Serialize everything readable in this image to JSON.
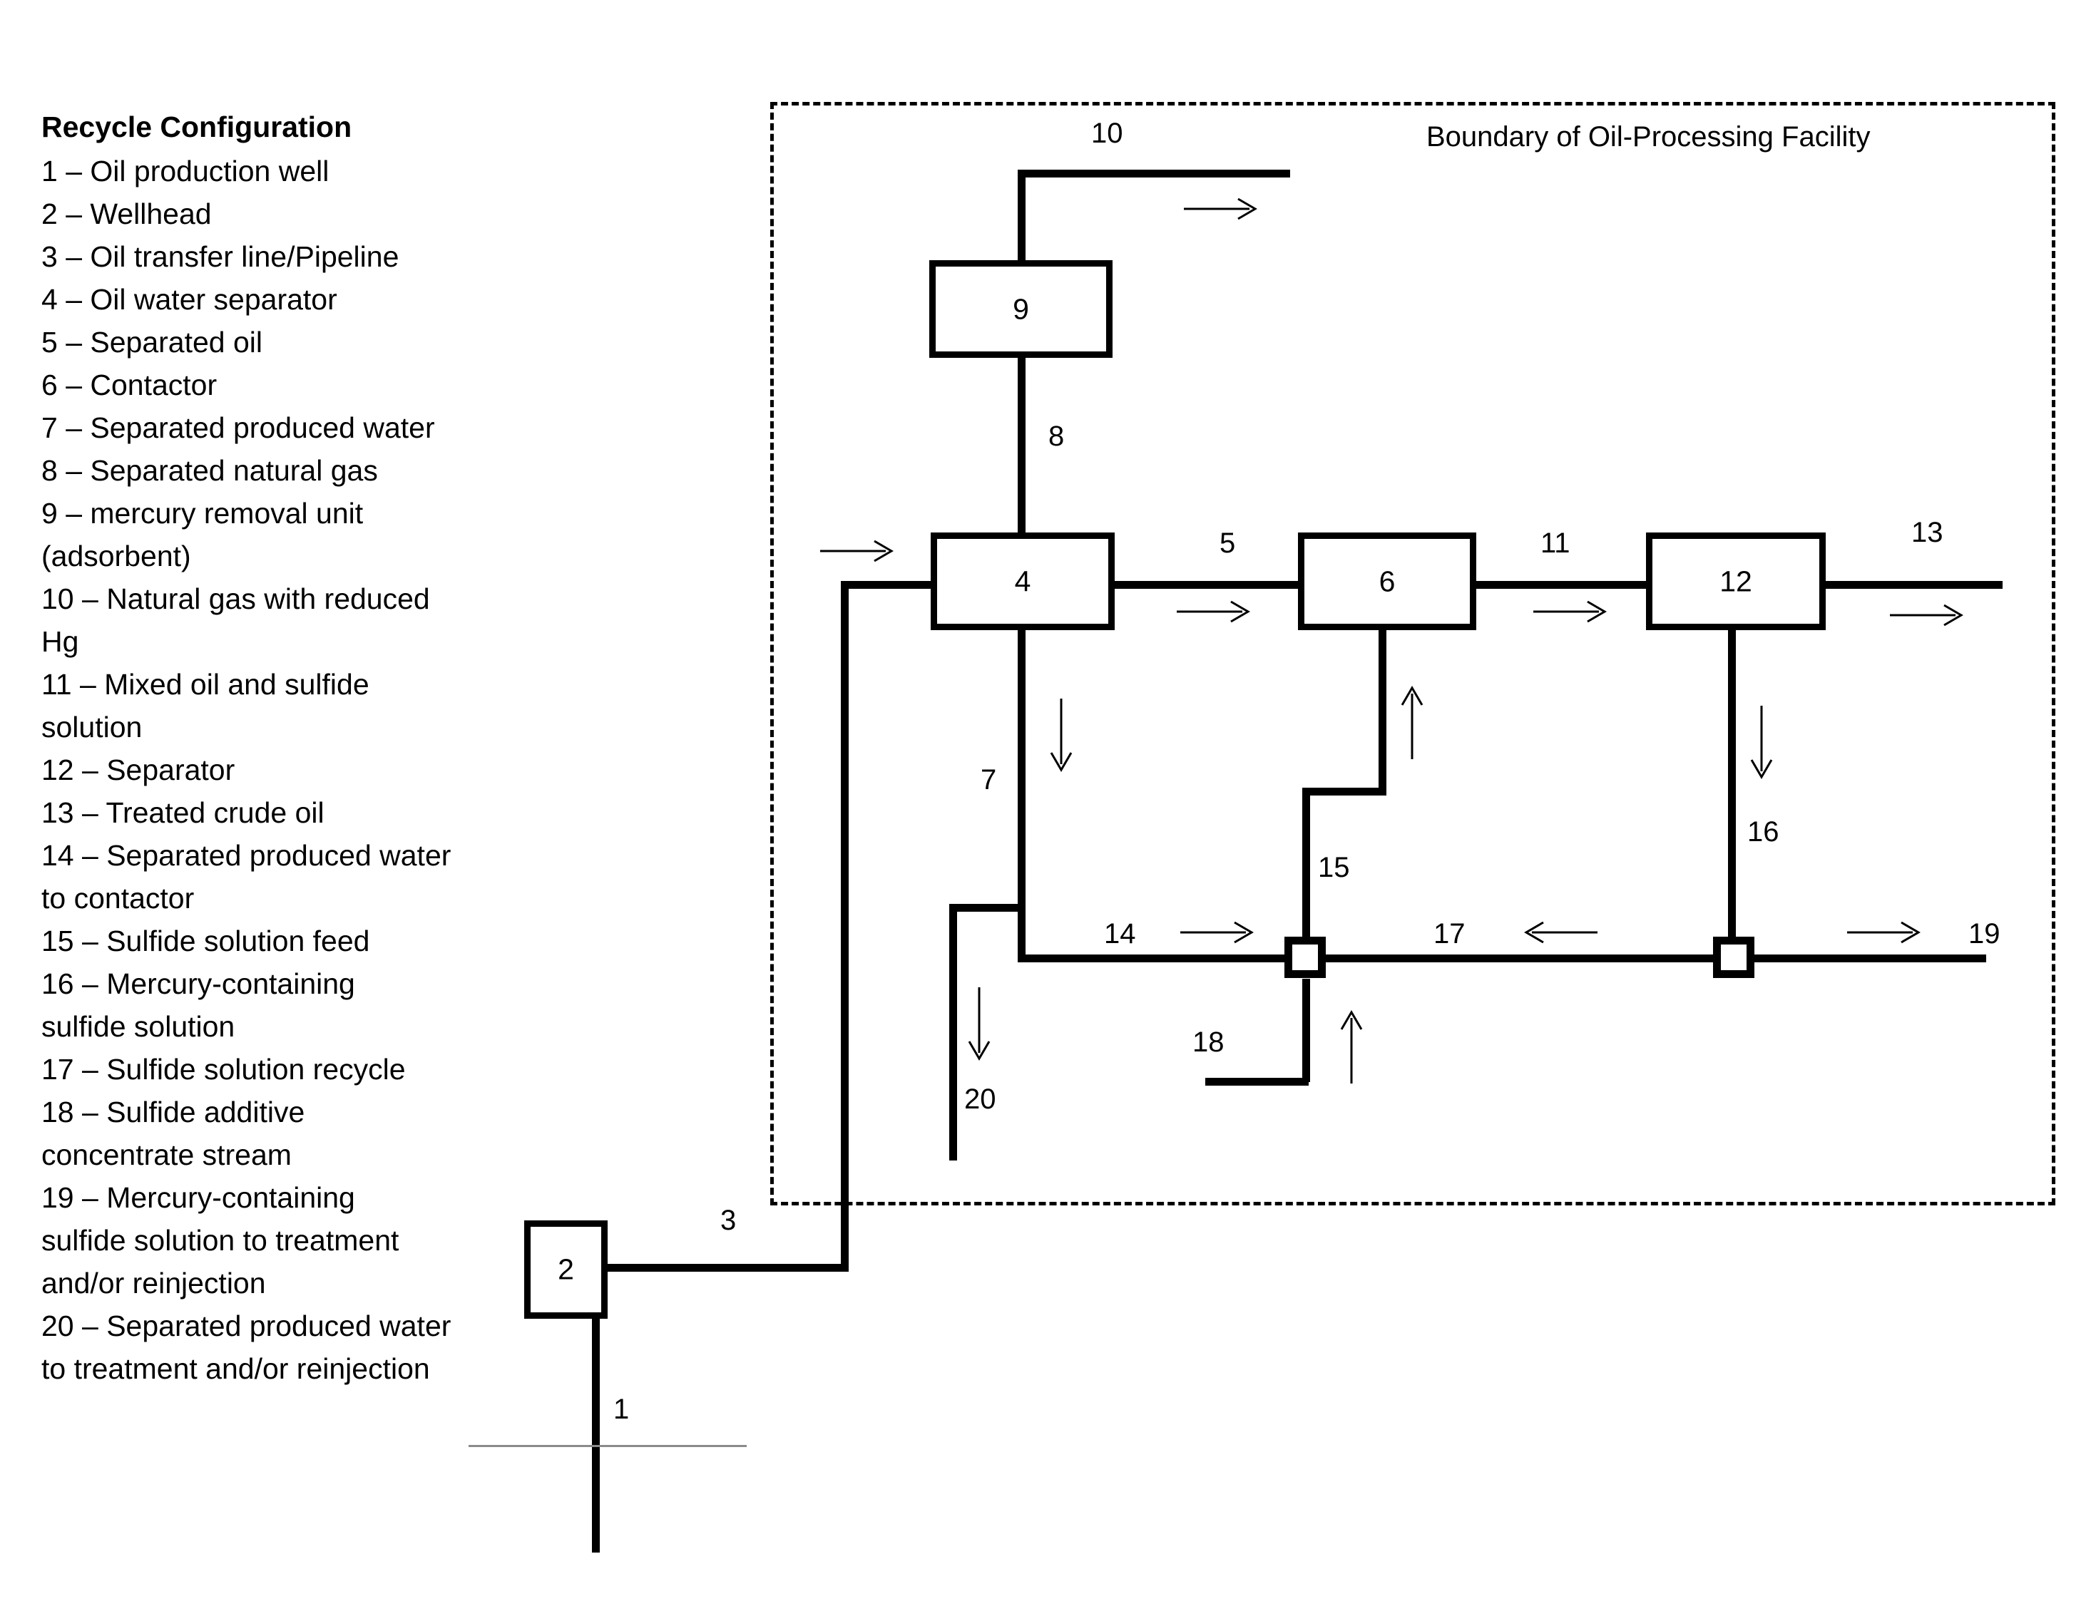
{
  "legend": {
    "title": "Recycle Configuration",
    "items": [
      "1 – Oil production well",
      "2 – Wellhead",
      "3 – Oil transfer line/Pipeline",
      "4 – Oil water separator",
      "5 – Separated oil",
      "6 – Contactor",
      "7 – Separated  produced water",
      "8 – Separated natural gas",
      "9 – mercury removal unit",
      "(adsorbent)",
      "10 – Natural gas with reduced",
      "Hg",
      "11 – Mixed oil and sulfide",
      "solution",
      "12 – Separator",
      "13 – Treated crude oil",
      "14 – Separated produced water",
      "to contactor",
      "15 – Sulfide solution feed",
      "16 – Mercury-containing",
      "sulfide solution",
      "17 – Sulfide solution recycle",
      "18 – Sulfide additive",
      "concentrate stream",
      "19 – Mercury-containing",
      "sulfide solution to treatment",
      "and/or reinjection",
      "20 – Separated produced water",
      "to treatment and/or reinjection"
    ]
  },
  "diagram": {
    "boundary_label": "Boundary of Oil-Processing Facility",
    "units": [
      {
        "id": "9",
        "name": "mercury removal unit (adsorbent)"
      },
      {
        "id": "4",
        "name": "Oil water separator"
      },
      {
        "id": "6",
        "name": "Contactor"
      },
      {
        "id": "12",
        "name": "Separator"
      },
      {
        "id": "2",
        "name": "Wellhead"
      }
    ],
    "streams": [
      {
        "id": "1",
        "name": "Oil production well",
        "direction": "down"
      },
      {
        "id": "3",
        "name": "Oil transfer line/Pipeline",
        "direction": "right"
      },
      {
        "id": "10",
        "name": "Natural gas with reduced Hg",
        "direction": "right"
      },
      {
        "id": "8",
        "name": "Separated natural gas",
        "direction": "up"
      },
      {
        "id": "5",
        "name": "Separated oil",
        "direction": "right"
      },
      {
        "id": "11",
        "name": "Mixed oil and sulfide solution",
        "direction": "right"
      },
      {
        "id": "13",
        "name": "Treated crude oil",
        "direction": "right"
      },
      {
        "id": "7",
        "name": "Separated produced water",
        "direction": "down"
      },
      {
        "id": "15",
        "name": "Sulfide solution feed",
        "direction": "up"
      },
      {
        "id": "16",
        "name": "Mercury-containing sulfide solution",
        "direction": "down"
      },
      {
        "id": "14",
        "name": "Separated produced water to contactor",
        "direction": "right"
      },
      {
        "id": "17",
        "name": "Sulfide solution recycle",
        "direction": "left"
      },
      {
        "id": "19",
        "name": "Mercury-containing sulfide solution to treatment and/or reinjection",
        "direction": "right"
      },
      {
        "id": "18",
        "name": "Sulfide additive concentrate stream",
        "direction": "up"
      },
      {
        "id": "20",
        "name": "Separated produced water to treatment and/or reinjection",
        "direction": "down"
      }
    ],
    "colors": {
      "line": "#000000",
      "background": "#ffffff",
      "ground": "#8b8b8b"
    }
  }
}
